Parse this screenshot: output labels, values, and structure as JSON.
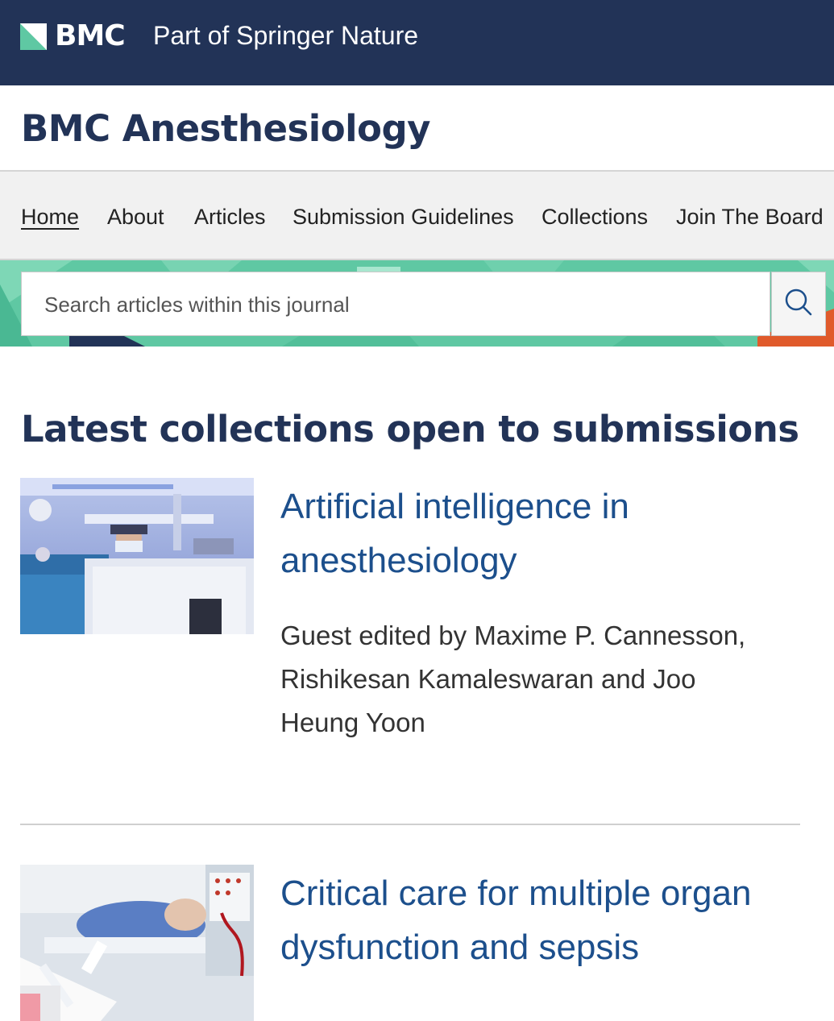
{
  "header": {
    "logo_text": "BMC",
    "tagline": "Part of Springer Nature",
    "brand_color": "#223357",
    "logo_accent": "#5fc8a3"
  },
  "journal": {
    "title": "BMC Anesthesiology"
  },
  "nav": {
    "items": [
      {
        "label": "Home",
        "active": true
      },
      {
        "label": "About",
        "active": false
      },
      {
        "label": "Articles",
        "active": false
      },
      {
        "label": "Submission Guidelines",
        "active": false
      },
      {
        "label": "Collections",
        "active": false
      },
      {
        "label": "Join The Board",
        "active": false
      }
    ]
  },
  "search": {
    "placeholder": "Search articles within this journal",
    "button_icon": "search-icon"
  },
  "main": {
    "section_title": "Latest collections open to submissions",
    "collections": [
      {
        "title": "Artificial intelligence in anesthesiology",
        "editors": "Guest edited by Maxime P. Cannesson, Rishikesan Kamaleswaran and Joo Heung Yoon",
        "image_alt": "operating-room-photo"
      },
      {
        "title": "Critical care for multiple organ dysfunction and sepsis",
        "image_alt": "intensive-care-photo"
      }
    ]
  }
}
